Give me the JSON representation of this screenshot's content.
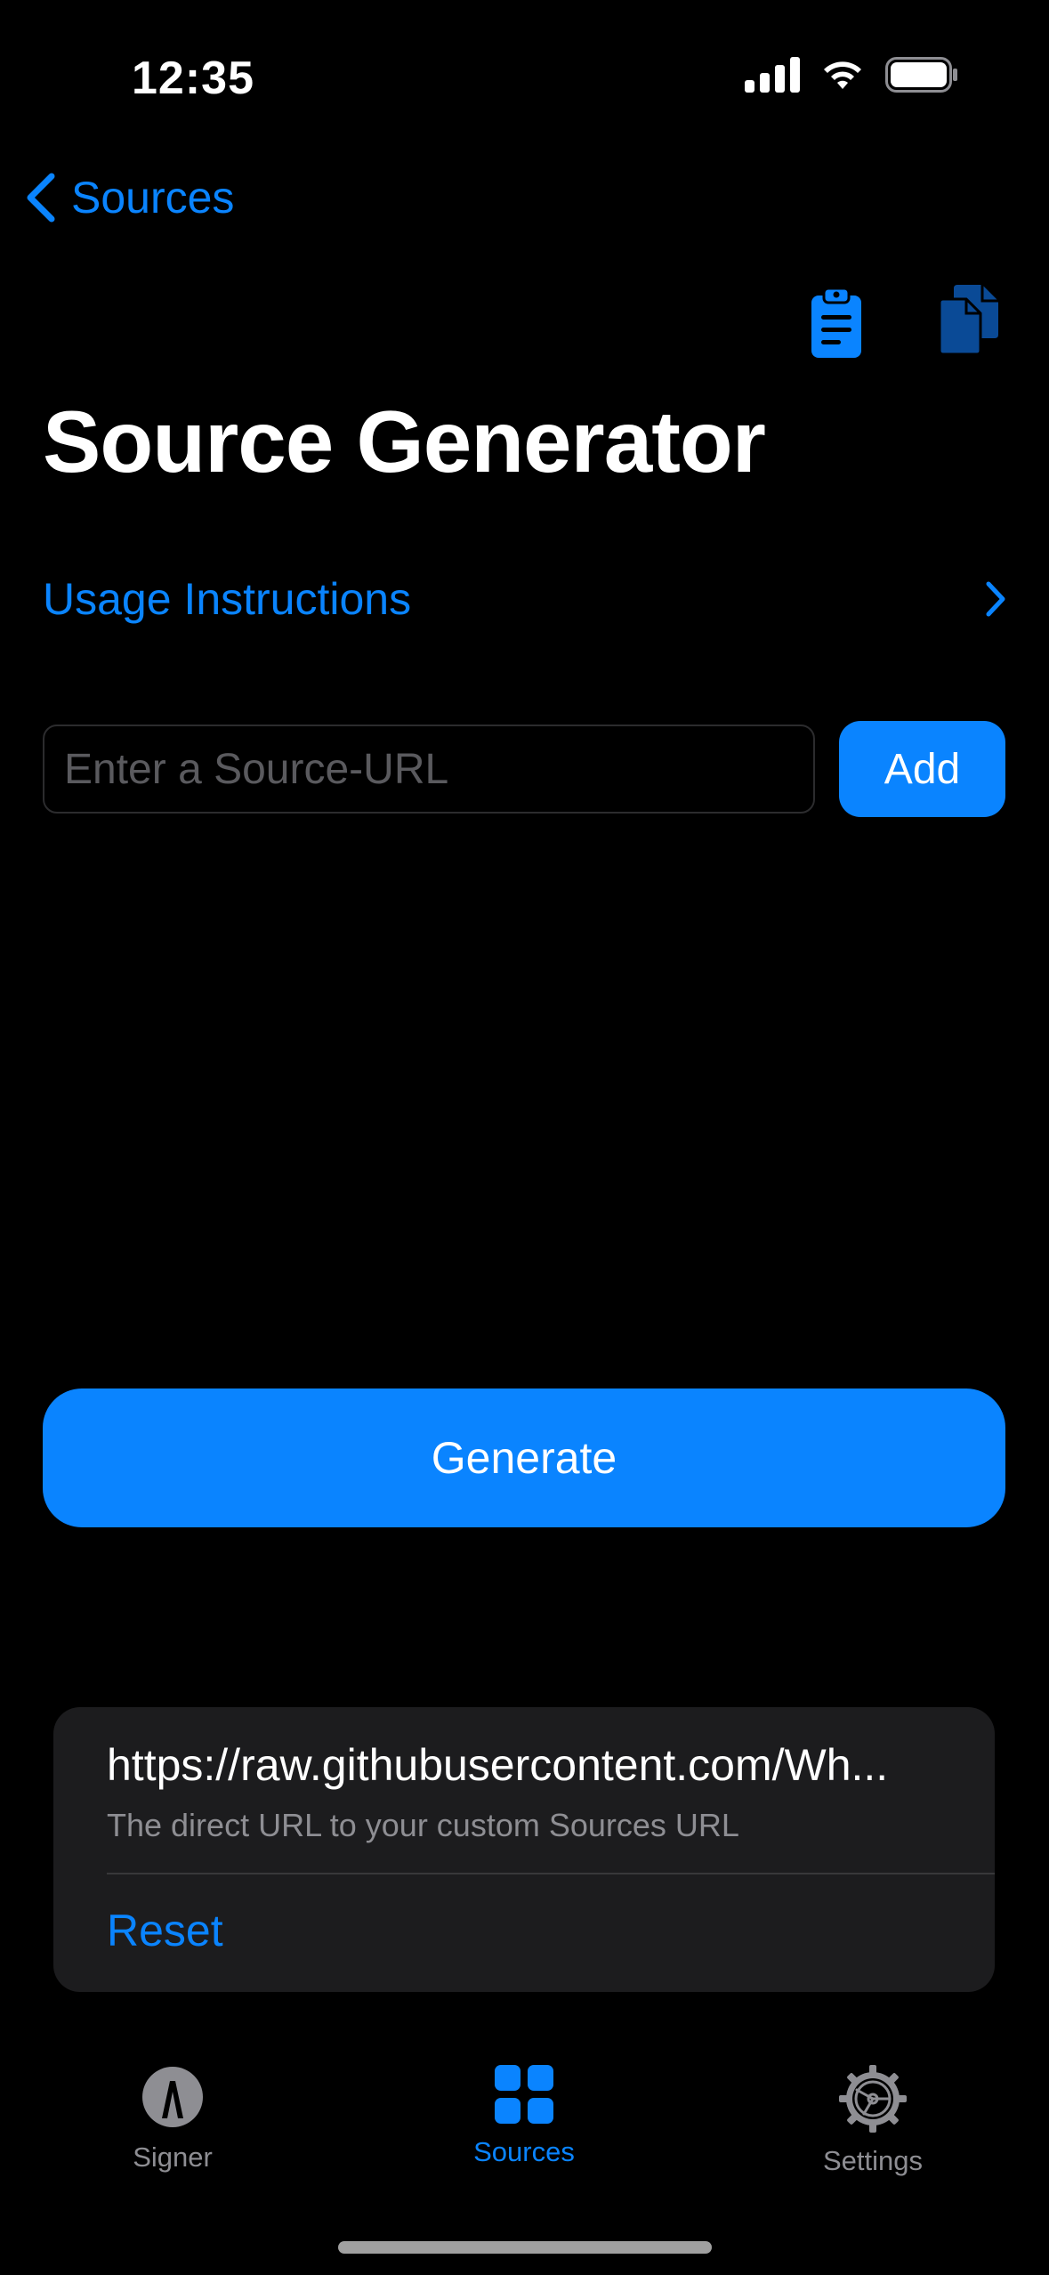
{
  "status_bar": {
    "time": "12:35"
  },
  "nav": {
    "back_label": "Sources"
  },
  "page": {
    "title": "Source Generator"
  },
  "usage": {
    "label": "Usage Instructions"
  },
  "source_input": {
    "placeholder": "Enter a Source-URL",
    "value": ""
  },
  "add_button": {
    "label": "Add"
  },
  "generate_button": {
    "label": "Generate"
  },
  "result_card": {
    "url": "https://raw.githubusercontent.com/Wh...",
    "description": "The direct URL to your custom Sources URL",
    "reset_label": "Reset"
  },
  "tab_bar": {
    "items": [
      {
        "label": "Signer",
        "icon": "signer-icon",
        "active": false
      },
      {
        "label": "Sources",
        "icon": "grid-icon",
        "active": true
      },
      {
        "label": "Settings",
        "icon": "gear-icon",
        "active": false
      }
    ]
  },
  "colors": {
    "accent": "#0a84ff",
    "background": "#000000",
    "card": "#1c1c1e",
    "secondary_text": "#8e8e93"
  }
}
